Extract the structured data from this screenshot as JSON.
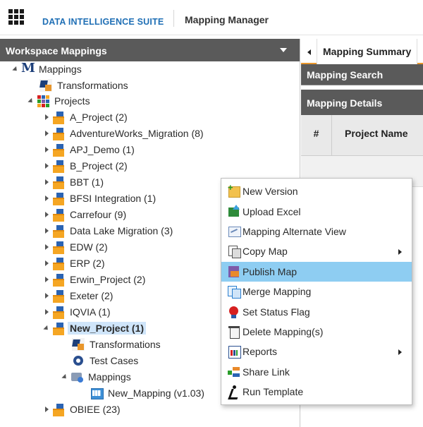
{
  "header": {
    "app_title": "DATA INTELLIGENCE SUITE",
    "module_title": "Mapping Manager"
  },
  "workspace": {
    "panel_title": "Workspace Mappings",
    "tree": [
      {
        "label": "Mappings",
        "icon": "mapping-root-icon"
      },
      {
        "label": "Transformations",
        "icon": "transformations-icon"
      },
      {
        "label": "Projects",
        "icon": "projects-icon"
      },
      {
        "label": "A_Project (2)",
        "icon": "project-folder-icon"
      },
      {
        "label": "AdventureWorks_Migration (8)",
        "icon": "project-folder-icon"
      },
      {
        "label": "APJ_Demo (1)",
        "icon": "project-folder-icon"
      },
      {
        "label": "B_Project (2)",
        "icon": "project-folder-icon"
      },
      {
        "label": "BBT (1)",
        "icon": "project-folder-icon"
      },
      {
        "label": "BFSI Integration (1)",
        "icon": "project-folder-icon"
      },
      {
        "label": "Carrefour (9)",
        "icon": "project-folder-icon"
      },
      {
        "label": "Data Lake Migration (3)",
        "icon": "project-folder-icon"
      },
      {
        "label": "EDW (2)",
        "icon": "project-folder-icon"
      },
      {
        "label": "ERP (2)",
        "icon": "project-folder-icon"
      },
      {
        "label": "Erwin_Project (2)",
        "icon": "project-folder-icon"
      },
      {
        "label": "Exeter (2)",
        "icon": "project-folder-icon"
      },
      {
        "label": "IQVIA (1)",
        "icon": "project-folder-icon"
      },
      {
        "label": "New_Project (1)",
        "icon": "project-folder-icon",
        "selected": true
      },
      {
        "label": "Transformations",
        "icon": "transformations-icon"
      },
      {
        "label": "Test Cases",
        "icon": "test-cases-icon"
      },
      {
        "label": "Mappings",
        "icon": "mappings-folder-icon"
      },
      {
        "label": "New_Mapping (v1.03)",
        "icon": "mapping-icon"
      },
      {
        "label": "OBIEE (23)",
        "icon": "project-folder-icon"
      }
    ]
  },
  "summary": {
    "tab_label": "Mapping Summary",
    "search_header": "Mapping Search",
    "details_header": "Mapping Details",
    "col_number": "#",
    "col_project": "Project Name"
  },
  "context_menu": {
    "items": [
      {
        "label": "New Version",
        "icon": "new-version-icon"
      },
      {
        "label": "Upload Excel",
        "icon": "upload-excel-icon"
      },
      {
        "label": "Mapping Alternate View",
        "icon": "alternate-view-icon"
      },
      {
        "label": "Copy Map",
        "icon": "copy-map-icon",
        "submenu": true
      },
      {
        "label": "Publish Map",
        "icon": "publish-map-icon",
        "highlighted": true
      },
      {
        "label": "Merge Mapping",
        "icon": "merge-mapping-icon"
      },
      {
        "label": "Set Status Flag",
        "icon": "status-flag-icon"
      },
      {
        "label": "Delete Mapping(s)",
        "icon": "delete-icon"
      },
      {
        "label": "Reports",
        "icon": "reports-icon",
        "submenu": true
      },
      {
        "label": "Share Link",
        "icon": "share-link-icon"
      },
      {
        "label": "Run Template",
        "icon": "run-template-icon"
      }
    ]
  },
  "colors": {
    "accent": "#e8962b",
    "header_bg": "#5a5a5a",
    "highlight": "#8ecdf2",
    "selection": "#cfe5fa",
    "brand_blue": "#1f6fb5"
  }
}
